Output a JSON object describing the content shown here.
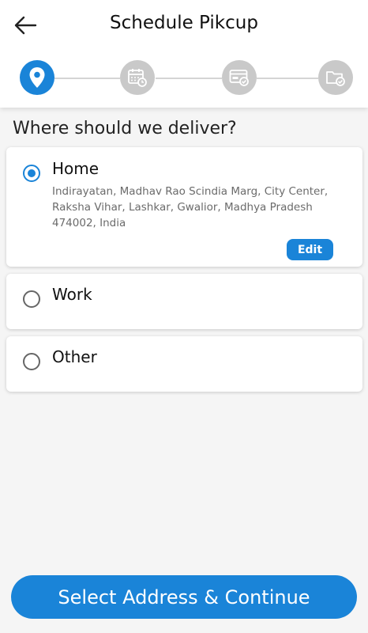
{
  "header": {
    "title": "Schedule Pikcup",
    "back_icon": "arrow-left-icon"
  },
  "stepper": {
    "steps": [
      {
        "icon": "location-pin-icon",
        "active": true
      },
      {
        "icon": "calendar-clock-icon",
        "active": false
      },
      {
        "icon": "payment-card-check-icon",
        "active": false
      },
      {
        "icon": "folder-check-icon",
        "active": false
      }
    ],
    "active_color": "#1a84d8",
    "inactive_color": "#c9c9c9"
  },
  "section_title": "Where should we deliver?",
  "addresses": [
    {
      "label": "Home",
      "selected": true,
      "address": "Indirayatan, Madhav Rao Scindia Marg, City Center, Raksha Vihar, Lashkar, Gwalior, Madhya Pradesh 474002, India",
      "edit_label": "Edit"
    },
    {
      "label": "Work",
      "selected": false
    },
    {
      "label": "Other",
      "selected": false
    }
  ],
  "cta_label": "Select Address & Continue",
  "colors": {
    "accent": "#1a84d8",
    "background": "#f5f5f5"
  }
}
